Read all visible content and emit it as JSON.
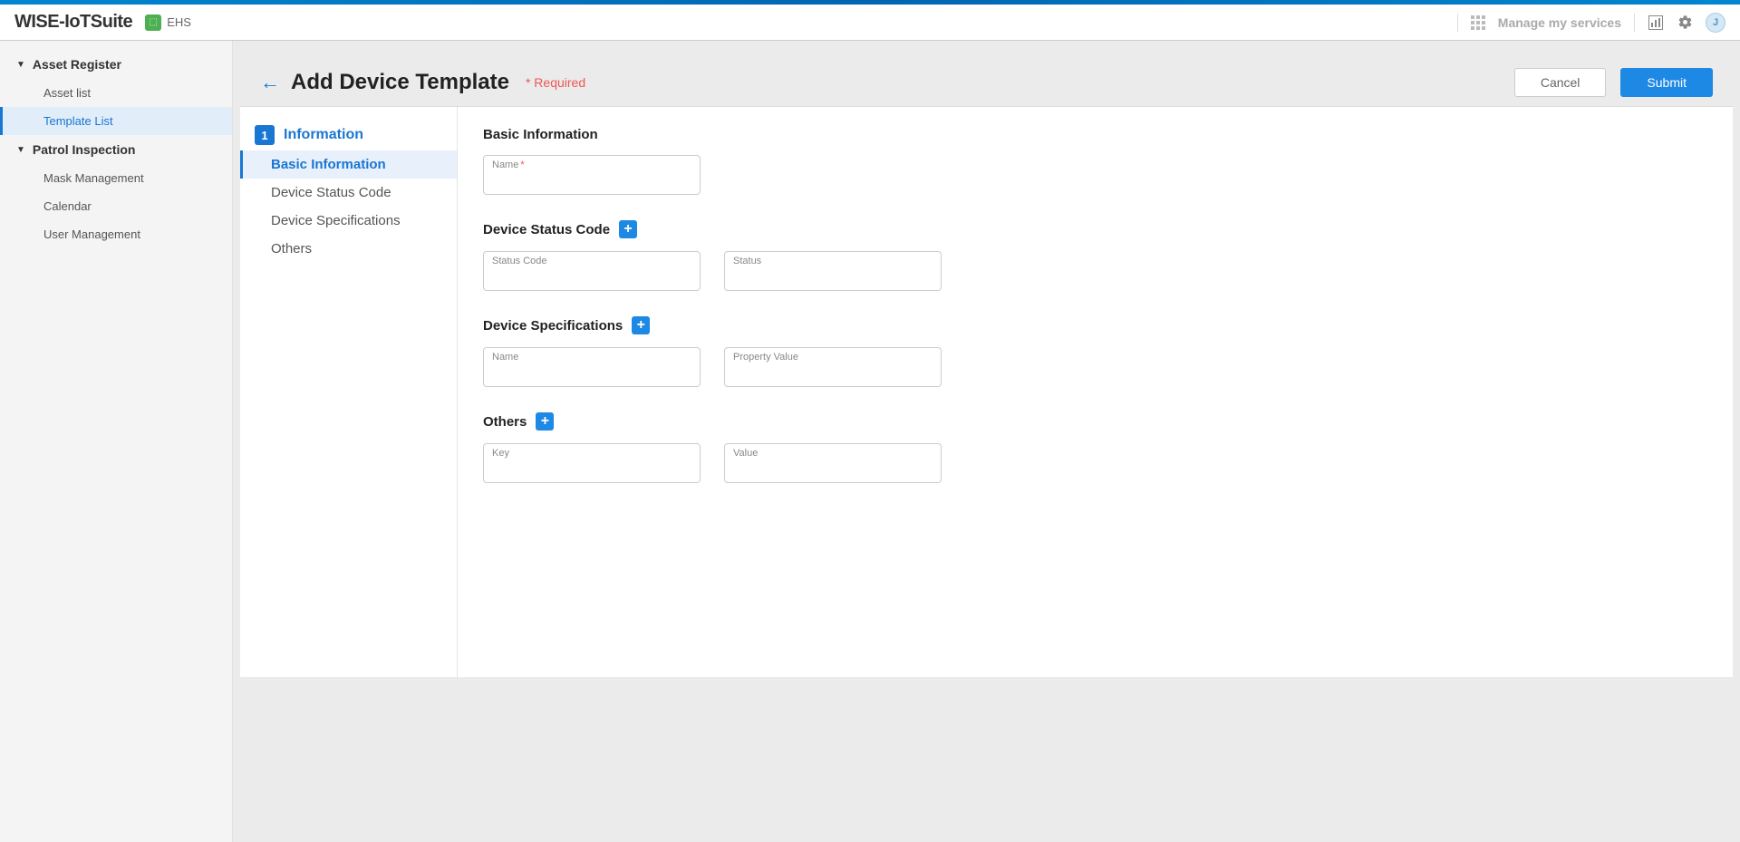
{
  "header": {
    "brand_wise": "WISE-",
    "brand_iot": "IoT",
    "brand_suite": "Suite",
    "app_label": "EHS",
    "manage_label": "Manage my services",
    "avatar_initial": "J"
  },
  "sidebar": {
    "groups": [
      {
        "label": "Asset Register",
        "items": [
          "Asset list",
          "Template List"
        ]
      },
      {
        "label": "Patrol Inspection",
        "items": [
          "Mask Management",
          "Calendar",
          "User Management"
        ]
      }
    ]
  },
  "page": {
    "title": "Add Device Template",
    "required_hint": "* Required",
    "cancel_label": "Cancel",
    "submit_label": "Submit"
  },
  "step_nav": {
    "step_number": "1",
    "step_label": "Information",
    "subs": [
      "Basic Information",
      "Device Status Code",
      "Device Specifications",
      "Others"
    ]
  },
  "form": {
    "basic": {
      "heading": "Basic Information",
      "name_label": "Name"
    },
    "status": {
      "heading": "Device Status Code",
      "code_label": "Status Code",
      "status_label": "Status"
    },
    "specs": {
      "heading": "Device Specifications",
      "name_label": "Name",
      "value_label": "Property Value"
    },
    "others": {
      "heading": "Others",
      "key_label": "Key",
      "value_label": "Value"
    }
  }
}
